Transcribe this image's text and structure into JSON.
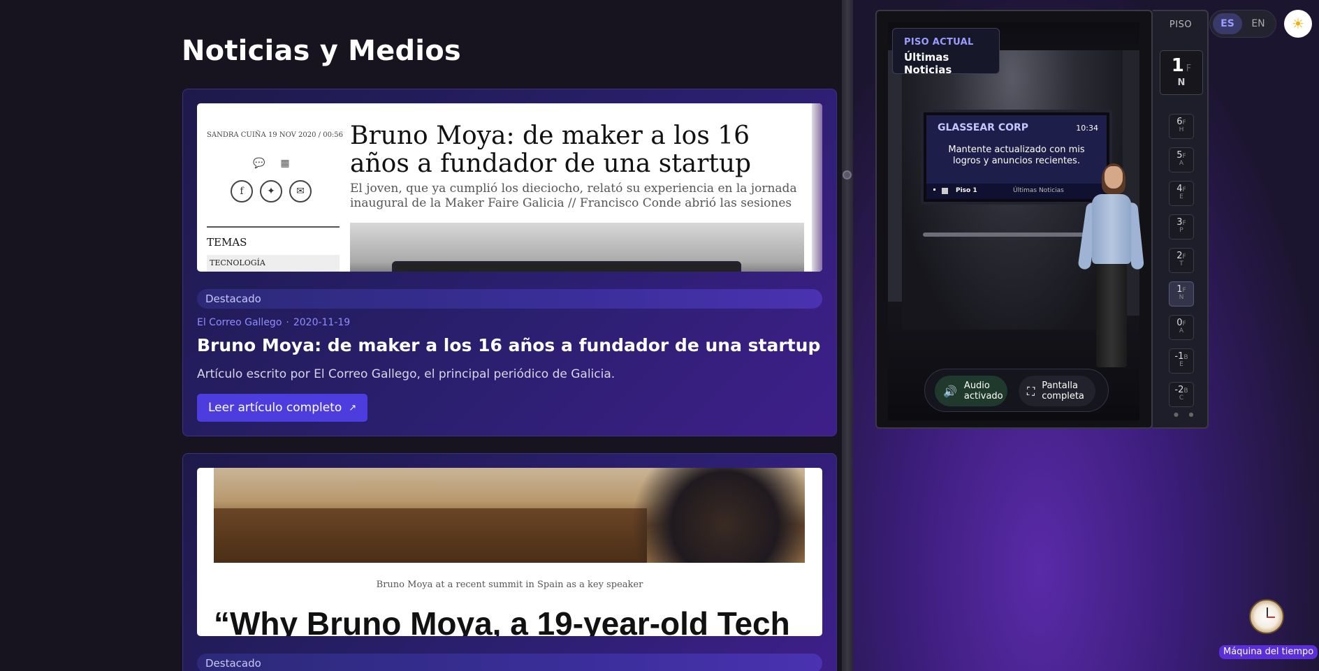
{
  "page": {
    "title": "Noticias y Medios"
  },
  "articles": [
    {
      "image": {
        "byline": "SANDRA CUIÑA   19 NOV 2020 / 00:56",
        "headline": "Bruno Moya: de maker a los 16 años a fundador de una startup",
        "subheadline": "El joven, que ya cumplió los dieciocho, relató su experiencia en la jornada inaugural de la Maker Faire Galicia // Francisco Conde abrió las sesiones",
        "temas": "TEMAS",
        "tag": "TECNOLOGÍA"
      },
      "badge": "Destacado",
      "source": "El Correo Gallego",
      "date": "2020-11-19",
      "title": "Bruno Moya: de maker a los 16 años a fundador de una startup",
      "description": "Artículo escrito por El Correo Gallego, el principal periódico de Galicia.",
      "button": "Leer artículo completo"
    },
    {
      "image": {
        "caption": "Bruno Moya at a recent summit in Spain as a key speaker",
        "headline": "“Why Bruno Moya, a 19-year-old Tech"
      },
      "badge": "Destacado"
    }
  ],
  "elevator": {
    "current_floor_label": "PISO ACTUAL",
    "current_floor_name": "Últimas Noticias",
    "screen": {
      "company": "GLASSEAR CORP",
      "time": "10:34",
      "message": "Mantente actualizado con mis logros y anuncios recientes.",
      "footer_floor": "Piso 1",
      "footer_name": "Últimas Noticias"
    },
    "audio_button": "Audio activado",
    "fullscreen_button": "Pantalla completa"
  },
  "floor_panel": {
    "title": "PISO",
    "current": {
      "number": "1",
      "suffix": "F",
      "letter": "N"
    },
    "floors": [
      {
        "number": "6",
        "suffix": "F",
        "letter": "H",
        "active": false
      },
      {
        "number": "5",
        "suffix": "F",
        "letter": "A",
        "active": false
      },
      {
        "number": "4",
        "suffix": "F",
        "letter": "E",
        "active": false
      },
      {
        "number": "3",
        "suffix": "F",
        "letter": "P",
        "active": false
      },
      {
        "number": "2",
        "suffix": "F",
        "letter": "T",
        "active": false
      },
      {
        "number": "1",
        "suffix": "F",
        "letter": "N",
        "active": true
      },
      {
        "number": "0",
        "suffix": "F",
        "letter": "A",
        "active": false
      },
      {
        "number": "-1",
        "suffix": "B",
        "letter": "E",
        "active": false
      },
      {
        "number": "-2",
        "suffix": "B",
        "letter": "C",
        "active": false
      }
    ]
  },
  "language": {
    "es": "ES",
    "en": "EN",
    "selected": "ES"
  },
  "time_machine": {
    "label": "Máquina del tiempo"
  },
  "colors": {
    "accent": "#4d3ddf",
    "background": "#17141f",
    "link": "#8f8cff"
  }
}
